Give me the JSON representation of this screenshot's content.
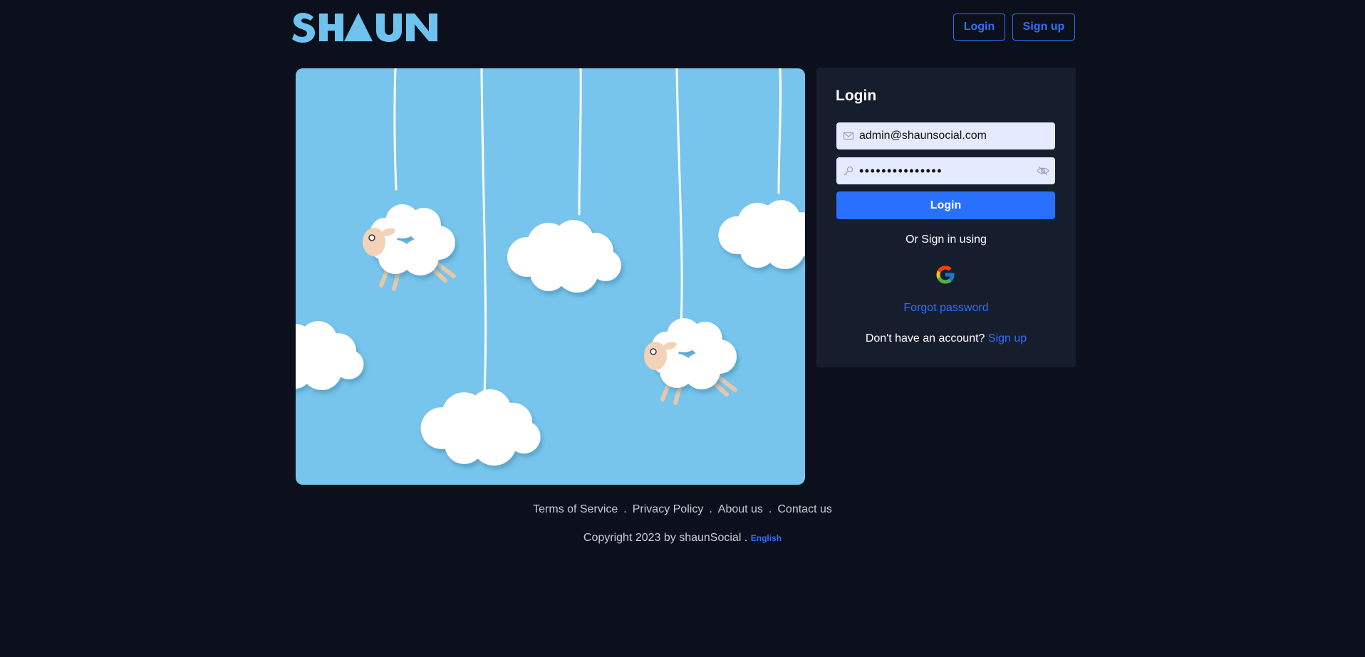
{
  "header": {
    "logo_text": "SHAUN",
    "login_label": "Login",
    "signup_label": "Sign up"
  },
  "colors": {
    "background": "#0c101c",
    "panel": "#161d2d",
    "accent": "#2970ff",
    "logo": "#6ec3ee",
    "sky": "#77c5ec"
  },
  "login": {
    "title": "Login",
    "email_value": "admin@shaunsocial.com",
    "password_value": "•••••••••••••••",
    "submit_label": "Login",
    "or_text": "Or Sign in using",
    "forgot_label": "Forgot password",
    "no_account_text": "Don't have an account?",
    "signup_link": "Sign up"
  },
  "icons": {
    "email": "mail-icon",
    "password": "key-icon",
    "toggle": "eye-off-icon",
    "social": "google-icon"
  },
  "footer": {
    "links": [
      "Terms of Service",
      "Privacy Policy",
      "About us",
      "Contact us"
    ],
    "copyright": "Copyright 2023 by shaunSocial .",
    "language": "English"
  }
}
